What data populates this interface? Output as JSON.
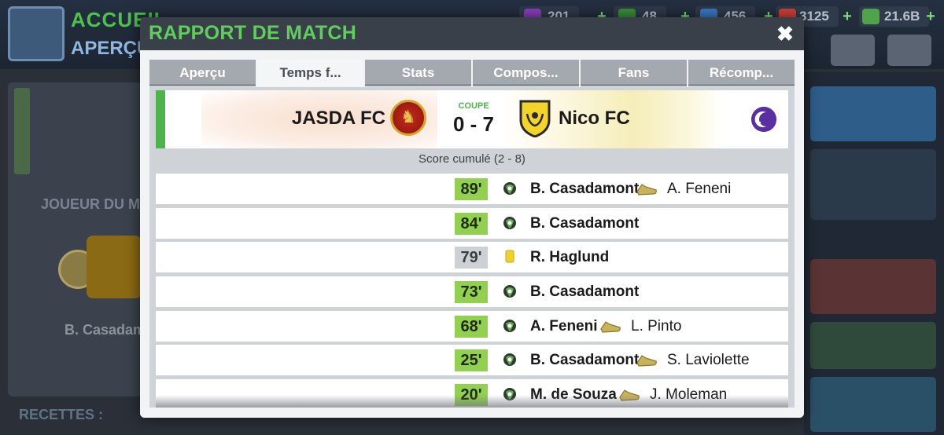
{
  "background": {
    "title_main": "ACCUEIL",
    "title_sub": "APERÇU",
    "joueur_label": "JOUEUR DU M",
    "player_name": "B. Casadamont",
    "recettes_label": "RECETTES :",
    "resources": [
      {
        "name": "tokens",
        "value": "201",
        "icon": "token-icon",
        "color": "#8a3fbf"
      },
      {
        "name": "cash-badge",
        "value": "48",
        "icon": "cash-badge-icon",
        "color": "#3a8f3a"
      },
      {
        "name": "training",
        "value": "456",
        "icon": "training-icon",
        "color": "#3b79c4"
      },
      {
        "name": "fans",
        "value": "3125",
        "icon": "fans-icon",
        "color": "#d0413a"
      },
      {
        "name": "money",
        "value": "21.6B",
        "icon": "money-icon",
        "color": "#4fa34a"
      }
    ]
  },
  "modal": {
    "title": "RAPPORT DE MATCH",
    "close_glyph": "✖",
    "tabs": [
      {
        "label": "Aperçu",
        "active": false
      },
      {
        "label": "Temps f...",
        "active": true
      },
      {
        "label": "Stats",
        "active": false
      },
      {
        "label": "Compos...",
        "active": false
      },
      {
        "label": "Fans",
        "active": false
      },
      {
        "label": "Récomp...",
        "active": false
      }
    ],
    "match": {
      "home_team": "JASDA FC",
      "away_team": "Nico FC",
      "competition": "COUPE",
      "score": "0 - 7",
      "home_crest_color": "#c02a1e",
      "away_crest_color": "#f2d42a"
    },
    "aggregate": "Score cumulé (2 - 8)",
    "events": [
      {
        "minute": "89'",
        "type": "goal",
        "player": "B. Casadamont",
        "assist": "A. Feneni"
      },
      {
        "minute": "84'",
        "type": "goal",
        "player": "B. Casadamont",
        "assist": ""
      },
      {
        "minute": "79'",
        "type": "yellow-card",
        "player": "R. Haglund",
        "assist": ""
      },
      {
        "minute": "73'",
        "type": "goal",
        "player": "B. Casadamont",
        "assist": ""
      },
      {
        "minute": "68'",
        "type": "goal",
        "player": "A. Feneni",
        "assist": "L. Pinto"
      },
      {
        "minute": "25'",
        "type": "goal",
        "player": "B. Casadamont",
        "assist": "S. Laviolette"
      },
      {
        "minute": "20'",
        "type": "goal",
        "player": "M. de Souza",
        "assist": "J. Moleman"
      }
    ]
  }
}
